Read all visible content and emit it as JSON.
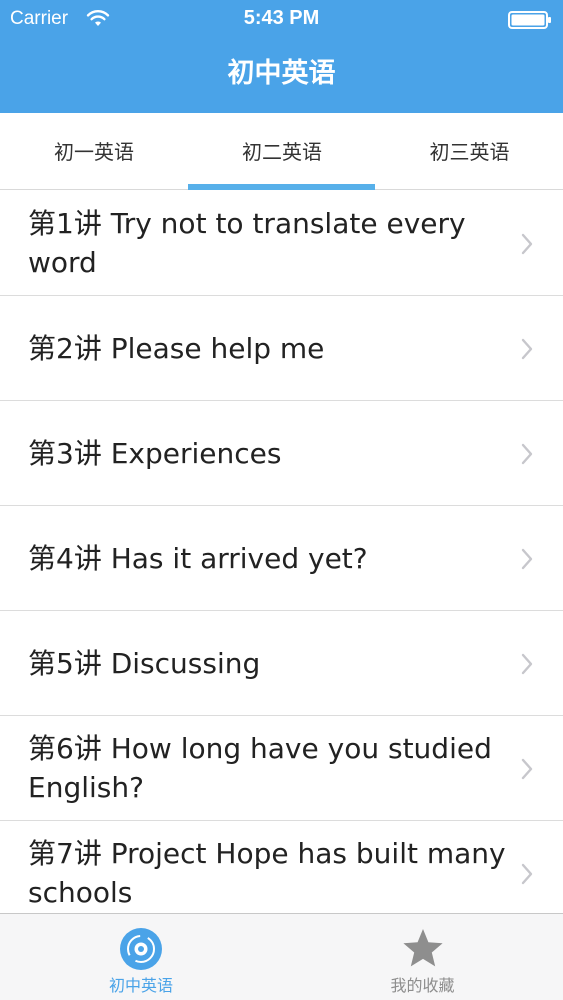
{
  "status_bar": {
    "carrier": "Carrier",
    "time": "5:43 PM"
  },
  "nav": {
    "title": "初中英语"
  },
  "segments": {
    "tabs": [
      {
        "label": "初一英语"
      },
      {
        "label": "初二英语",
        "selected": true
      },
      {
        "label": "初三英语"
      }
    ]
  },
  "lessons": {
    "items": [
      {
        "title": "第1讲 Try not to translate every word"
      },
      {
        "title": "第2讲 Please help me"
      },
      {
        "title": "第3讲 Experiences"
      },
      {
        "title": "第4讲 Has it arrived yet?"
      },
      {
        "title": "第5讲 Discussing"
      },
      {
        "title": "第6讲 How long have you studied English?"
      },
      {
        "title": "第7讲 Project Hope has built many schools"
      }
    ]
  },
  "tab_bar": {
    "items": [
      {
        "label": "初中英语",
        "icon": "disc-icon",
        "active": true
      },
      {
        "label": "我的收藏",
        "icon": "star-icon",
        "active": false
      }
    ]
  },
  "colors": {
    "accent": "#4aa3e8",
    "indicator": "#57b0ea",
    "tab_inactive": "#8e8e8e"
  }
}
